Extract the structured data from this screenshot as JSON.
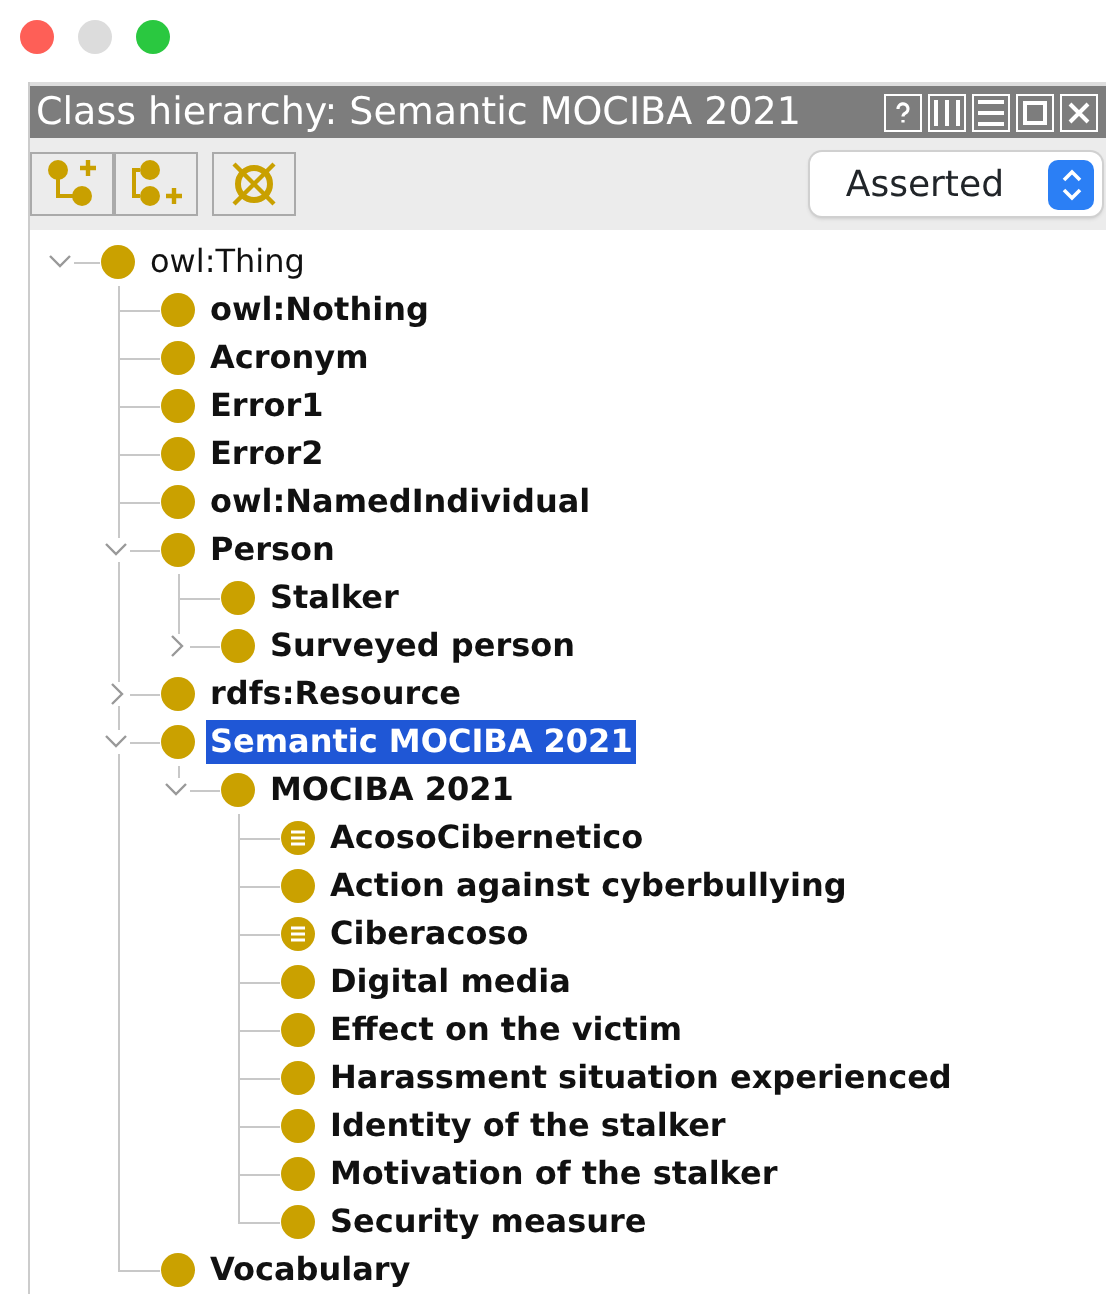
{
  "window": {
    "title": "Class hierarchy: Semantic MOCIBA 2021"
  },
  "toolbar": {
    "view_select": {
      "value": "Asserted"
    }
  },
  "tree": [
    {
      "label": "owl:Thing",
      "kind": "class",
      "bold": false,
      "selected": false,
      "expanded": true,
      "children": [
        {
          "label": "owl:Nothing",
          "kind": "class",
          "bold": true,
          "selected": false
        },
        {
          "label": "Acronym",
          "kind": "class",
          "bold": true,
          "selected": false
        },
        {
          "label": "Error1",
          "kind": "class",
          "bold": true,
          "selected": false
        },
        {
          "label": "Error2",
          "kind": "class",
          "bold": true,
          "selected": false
        },
        {
          "label": "owl:NamedIndividual",
          "kind": "class",
          "bold": true,
          "selected": false
        },
        {
          "label": "Person",
          "kind": "class",
          "bold": true,
          "selected": false,
          "expanded": true,
          "children": [
            {
              "label": "Stalker",
              "kind": "class",
              "bold": true,
              "selected": false
            },
            {
              "label": "Surveyed person",
              "kind": "class",
              "bold": true,
              "selected": false,
              "expanded": false
            }
          ]
        },
        {
          "label": "rdfs:Resource",
          "kind": "class",
          "bold": true,
          "selected": false,
          "expanded": false
        },
        {
          "label": "Semantic MOCIBA 2021",
          "kind": "class",
          "bold": true,
          "selected": true,
          "expanded": true,
          "children": [
            {
              "label": "MOCIBA 2021",
              "kind": "class",
              "bold": true,
              "selected": false,
              "expanded": true,
              "children": [
                {
                  "label": "AcosoCibernetico",
                  "kind": "defined",
                  "bold": true,
                  "selected": false
                },
                {
                  "label": "Action against cyberbullying",
                  "kind": "class",
                  "bold": true,
                  "selected": false
                },
                {
                  "label": "Ciberacoso",
                  "kind": "defined",
                  "bold": true,
                  "selected": false
                },
                {
                  "label": "Digital media",
                  "kind": "class",
                  "bold": true,
                  "selected": false
                },
                {
                  "label": "Effect on the victim",
                  "kind": "class",
                  "bold": true,
                  "selected": false
                },
                {
                  "label": "Harassment situation experienced",
                  "kind": "class",
                  "bold": true,
                  "selected": false
                },
                {
                  "label": "Identity of the stalker",
                  "kind": "class",
                  "bold": true,
                  "selected": false
                },
                {
                  "label": "Motivation of the stalker",
                  "kind": "class",
                  "bold": true,
                  "selected": false
                },
                {
                  "label": "Security measure",
                  "kind": "class",
                  "bold": true,
                  "selected": false
                }
              ]
            }
          ]
        },
        {
          "label": "Vocabulary",
          "kind": "class",
          "bold": true,
          "selected": false
        }
      ]
    }
  ]
}
